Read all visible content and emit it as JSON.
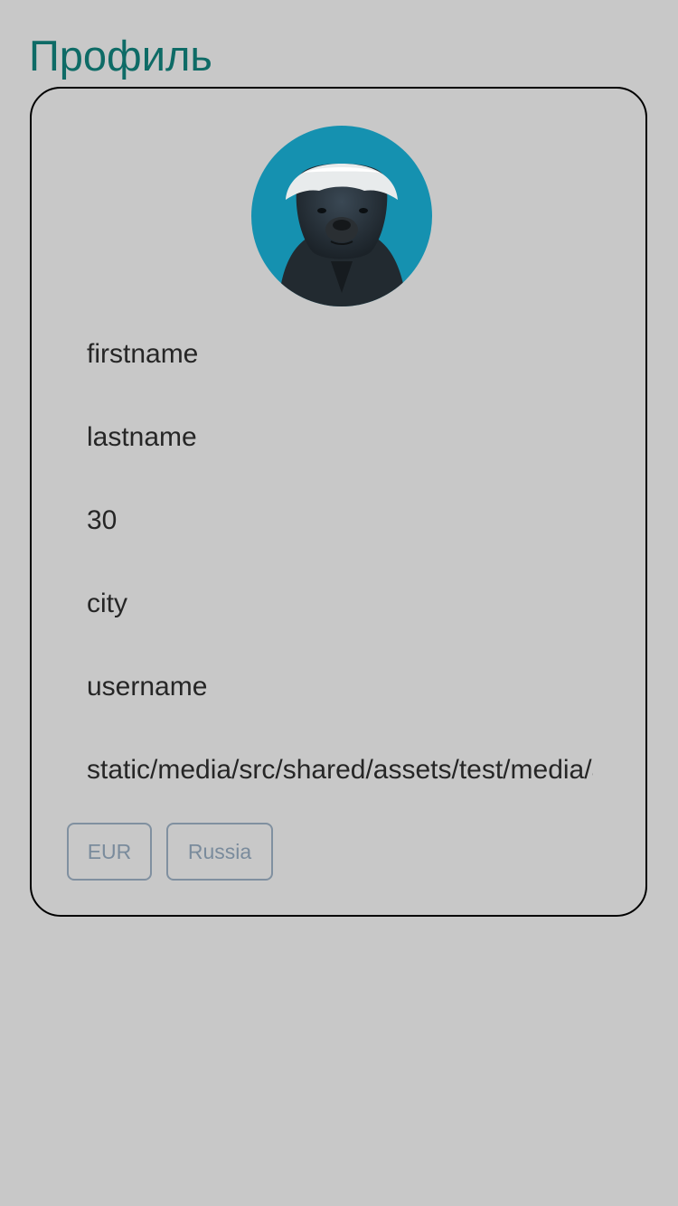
{
  "header": {
    "title": "Профиль"
  },
  "profile": {
    "avatar_icon": "honey-badger-avatar",
    "firstname": "firstname",
    "lastname": "lastname",
    "age": "30",
    "city": "city",
    "username": "username",
    "avatar_path": "static/media/src/shared/assets/test/media/avatar.jpg"
  },
  "selects": {
    "currency": "EUR",
    "country": "Russia"
  },
  "colors": {
    "background": "#c8c8c8",
    "title": "#0e6b66",
    "avatar_background": "#1591b0",
    "select_border": "#8090a0"
  }
}
